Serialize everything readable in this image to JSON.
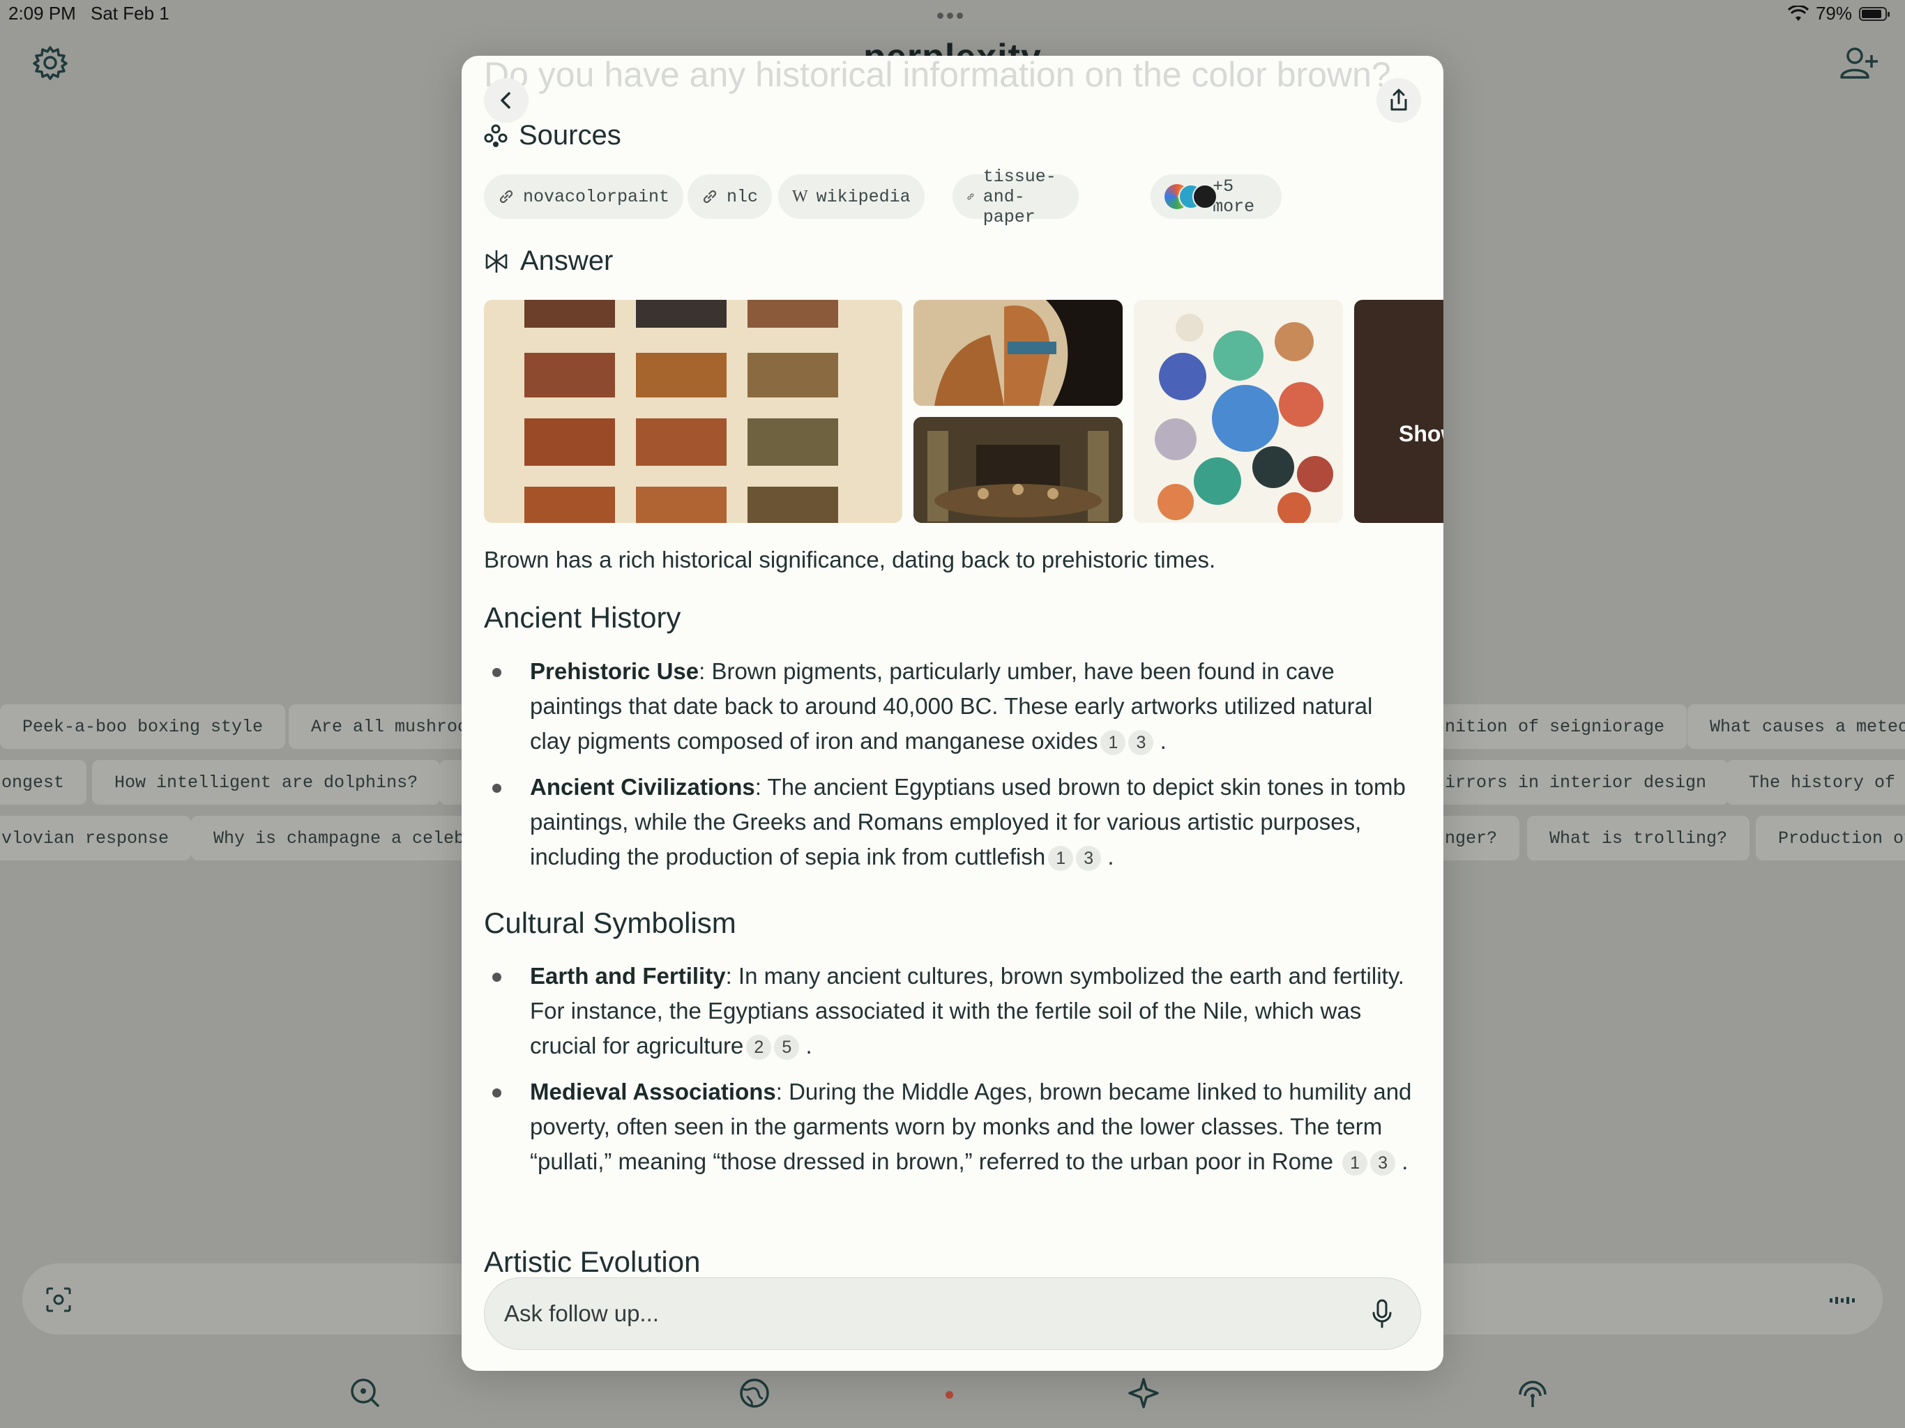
{
  "status": {
    "time": "2:09 PM",
    "date": "Sat Feb 1",
    "battery": "79%",
    "battery_level": 0.79
  },
  "app": {
    "title": "perplexity"
  },
  "trending": {
    "row1": [
      "Peek-a-boo boxing style",
      "Are all mushroo",
      "nition of seigniorage",
      "What causes a meteo"
    ],
    "row2": [
      "ongest",
      "How intelligent are dolphins?",
      "irrors in interior design",
      "The history of S"
    ],
    "row3": [
      "vlovian response",
      "Why is champagne a celebr",
      "nger?",
      "What is trolling?",
      "Production of"
    ]
  },
  "modal": {
    "question": "Do you have any historical information on the color brown?",
    "sources_title": "Sources",
    "sources": [
      {
        "label": "novacolorpaint",
        "icon": "link-icon"
      },
      {
        "label": "nlc",
        "icon": "link-icon"
      },
      {
        "label": "wikipedia",
        "icon": "wikipedia-icon"
      },
      {
        "label": "tissue-and-paper",
        "icon": "link-icon"
      }
    ],
    "more_sources": "+5 more",
    "answer_title": "Answer",
    "image_overlay_text": "Show",
    "intro": "Brown has a rich historical significance, dating back to prehistoric times.",
    "sections": [
      {
        "title": "Ancient History",
        "items": [
          {
            "term": "Prehistoric Use",
            "text": ": Brown pigments, particularly umber, have been found in cave paintings that date back to around 40,000 BC. These early artworks utilized natural clay pigments composed of iron and manganese oxides",
            "cites": [
              "1",
              "3"
            ]
          },
          {
            "term": "Ancient Civilizations",
            "text": ": The ancient Egyptians used brown to depict skin tones in tomb paintings, while the Greeks and Romans employed it for various artistic purposes, including the production of sepia ink from cuttlefish",
            "cites": [
              "1",
              "3"
            ]
          }
        ]
      },
      {
        "title": "Cultural Symbolism",
        "items": [
          {
            "term": "Earth and Fertility",
            "text": ": In many ancient cultures, brown symbolized the earth and fertility. For instance, the Egyptians associated it with the fertile soil of the Nile, which was crucial for agriculture",
            "cites": [
              "2",
              "5"
            ]
          },
          {
            "term": "Medieval Associations",
            "text": ": During the Middle Ages, brown became linked to humility and poverty, often seen in the garments worn by monks and the lower classes. The term “pullati,” meaning “those dressed in brown,” referred to the urban poor in Rome",
            "cites": [
              "1",
              "3"
            ]
          }
        ]
      },
      {
        "title": "Artistic Evolution"
      }
    ],
    "followup_placeholder": "Ask follow up..."
  },
  "colors": {
    "accent": "#1f6e6e",
    "modal_bg": "#fcfcf9",
    "backdrop": "#9a9b97"
  }
}
